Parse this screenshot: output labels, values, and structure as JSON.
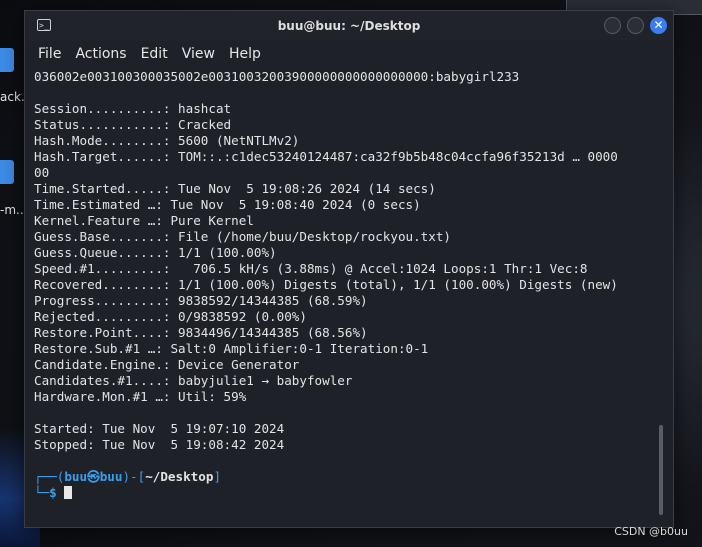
{
  "desktop": {
    "label_1": "ack.",
    "label_2": "-m..."
  },
  "window": {
    "title": "buu@buu: ~/Desktop",
    "close_glyph": "✕"
  },
  "menu": [
    "File",
    "Actions",
    "Edit",
    "View",
    "Help"
  ],
  "terminal": {
    "lines": [
      "036002e003100300035002e00310032003900000000000000000:babygirl233",
      "",
      "Session..........: hashcat",
      "Status...........: Cracked",
      "Hash.Mode........: 5600 (NetNTLMv2)",
      "Hash.Target......: TOM::.:c1dec53240124487:ca32f9b5b48c04ccfa96f35213d … 0000",
      "00",
      "Time.Started.....: Tue Nov  5 19:08:26 2024 (14 secs)",
      "Time.Estimated …: Tue Nov  5 19:08:40 2024 (0 secs)",
      "Kernel.Feature …: Pure Kernel",
      "Guess.Base.......: File (/home/buu/Desktop/rockyou.txt)",
      "Guess.Queue......: 1/1 (100.00%)",
      "Speed.#1.........:   706.5 kH/s (3.88ms) @ Accel:1024 Loops:1 Thr:1 Vec:8",
      "Recovered........: 1/1 (100.00%) Digests (total), 1/1 (100.00%) Digests (new)",
      "Progress.........: 9838592/14344385 (68.59%)",
      "Rejected.........: 0/9838592 (0.00%)",
      "Restore.Point....: 9834496/14344385 (68.56%)",
      "Restore.Sub.#1 …: Salt:0 Amplifier:0-1 Iteration:0-1",
      "Candidate.Engine.: Device Generator",
      "Candidates.#1....: babyjulie1 → babyfowler",
      "Hardware.Mon.#1 …: Util: 59%",
      "",
      "Started: Tue Nov  5 19:07:10 2024",
      "Stopped: Tue Nov  5 19:08:42 2024",
      ""
    ],
    "prompt": {
      "top_prefix": "┌──(",
      "user": "buu",
      "at": "㉿",
      "host": "buu",
      "mid": ")-[",
      "cwd": "~/Desktop",
      "end": "]",
      "bottom_prefix": "└─",
      "dollar": "$ "
    }
  },
  "watermark": "CSDN @b0uu"
}
